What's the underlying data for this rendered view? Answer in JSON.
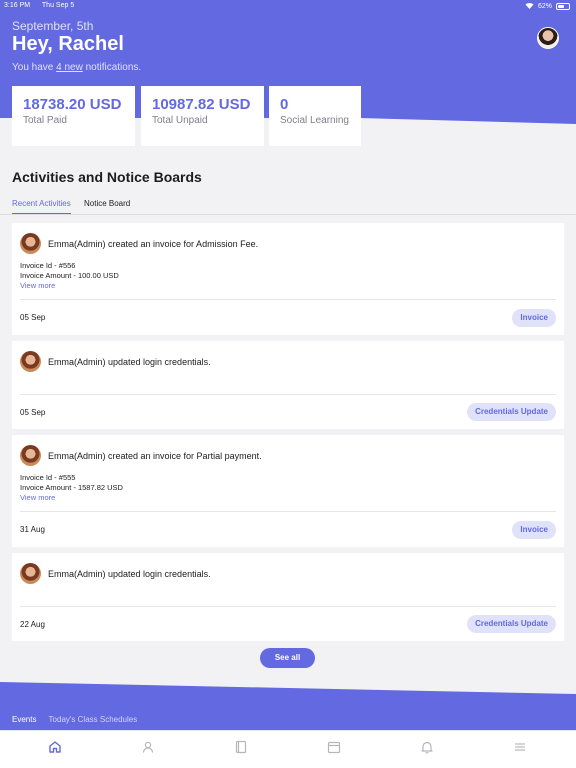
{
  "status_bar": {
    "time": "3:16 PM",
    "date": "Thu Sep 5",
    "battery": "62%",
    "battery_level": 0.62
  },
  "header": {
    "date": "September, 5th",
    "greeting": "Hey, Rachel",
    "notif_prefix": "You have",
    "notif_link": "4 new",
    "notif_suffix": "notifications."
  },
  "stats": [
    {
      "value": "18738.20 USD",
      "label": "Total Paid"
    },
    {
      "value": "10987.82 USD",
      "label": "Total Unpaid"
    },
    {
      "value": "0",
      "label": "Social Learning"
    }
  ],
  "section": {
    "title": "Activities and Notice Boards"
  },
  "tabs": [
    {
      "label": "Recent Activities",
      "active": true
    },
    {
      "label": "Notice Board",
      "active": false
    }
  ],
  "activities": [
    {
      "message": "Emma(Admin) created an invoice for Admission Fee.",
      "invoice_id": "Invoice Id - #556",
      "invoice_amount": "Invoice Amount - 100.00 USD",
      "view_more": "View more",
      "date": "05 Sep",
      "badge": "Invoice"
    },
    {
      "message": "Emma(Admin) updated login credentials.",
      "date": "05 Sep",
      "badge": "Credentials Update"
    },
    {
      "message": "Emma(Admin) created an invoice for Partial payment.",
      "invoice_id": "Invoice Id - #555",
      "invoice_amount": "Invoice Amount - 1587.82 USD",
      "view_more": "View more",
      "date": "31 Aug",
      "badge": "Invoice"
    },
    {
      "message": "Emma(Admin) updated login credentials.",
      "date": "22 Aug",
      "badge": "Credentials Update"
    }
  ],
  "see_all": "See all",
  "bottom_tabs": [
    {
      "label": "Events"
    },
    {
      "label": "Today's Class Schedules"
    }
  ],
  "nav": [
    {
      "icon": "home-icon",
      "active": true
    },
    {
      "icon": "user-icon"
    },
    {
      "icon": "book-icon"
    },
    {
      "icon": "calendar-icon"
    },
    {
      "icon": "bell-icon"
    },
    {
      "icon": "menu-icon"
    }
  ],
  "colors": {
    "accent": "#6369e0",
    "badge_bg": "#dfe2f8",
    "page_bg": "#f2f2f5"
  }
}
